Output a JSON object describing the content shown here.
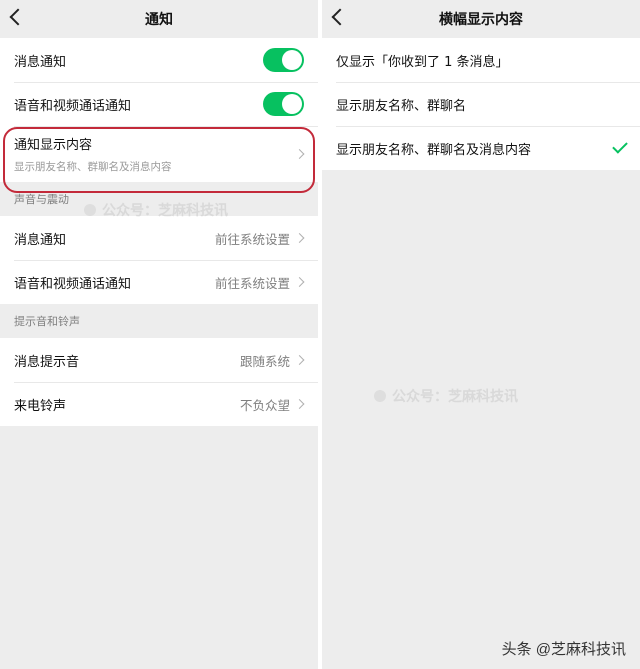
{
  "left_screen": {
    "title": "通知",
    "rows_top": {
      "message_notify": "消息通知",
      "call_notify": "语音和视频通话通知",
      "display_content": {
        "label": "通知显示内容",
        "subtitle": "显示朋友名称、群聊名及消息内容"
      }
    },
    "sections": {
      "sound_vibration": "声音与震动",
      "ringtones": "提示音和铃声"
    },
    "sound_rows": [
      {
        "label": "消息通知",
        "value": "前往系统设置"
      },
      {
        "label": "语音和视频通话通知",
        "value": "前往系统设置"
      }
    ],
    "ring_rows": [
      {
        "label": "消息提示音",
        "value": "跟随系统"
      },
      {
        "label": "来电铃声",
        "value": "不负众望"
      }
    ],
    "toggles": {
      "message_notify_on": true,
      "call_notify_on": true
    }
  },
  "right_screen": {
    "title": "横幅显示内容",
    "options": [
      {
        "label": "仅显示「你收到了 1 条消息」",
        "selected": false
      },
      {
        "label": "显示朋友名称、群聊名",
        "selected": false
      },
      {
        "label": "显示朋友名称、群聊名及消息内容",
        "selected": true
      }
    ]
  },
  "watermarks": {
    "left": "公众号：芝麻科技讯",
    "right": "公众号：芝麻科技讯"
  },
  "credit": "头条 @芝麻科技讯",
  "colors": {
    "accent_green": "#07c160",
    "highlight_red": "#c32a3a",
    "background": "#ededed"
  }
}
